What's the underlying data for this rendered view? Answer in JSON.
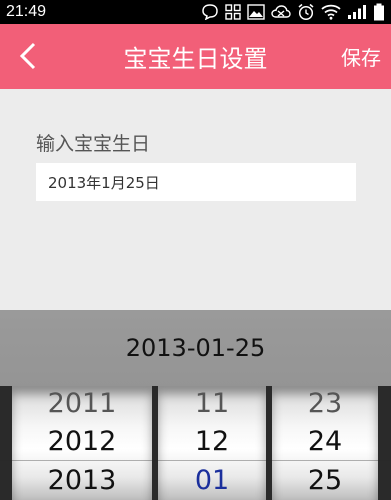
{
  "status_bar": {
    "time": "21:49"
  },
  "header": {
    "title": "宝宝生日设置",
    "save_label": "保存",
    "back_icon": "chevron-left-icon"
  },
  "form": {
    "label": "输入宝宝生日",
    "date_value": "2013年1月25日"
  },
  "picker": {
    "title": "2013-01-25",
    "years": [
      "2011",
      "2012",
      "2013"
    ],
    "months": [
      "11",
      "12",
      "01"
    ],
    "days": [
      "23",
      "24",
      "25"
    ]
  },
  "colors": {
    "header": "#f25f78",
    "background": "#ececec",
    "selected_month": "#1b2f9c"
  }
}
